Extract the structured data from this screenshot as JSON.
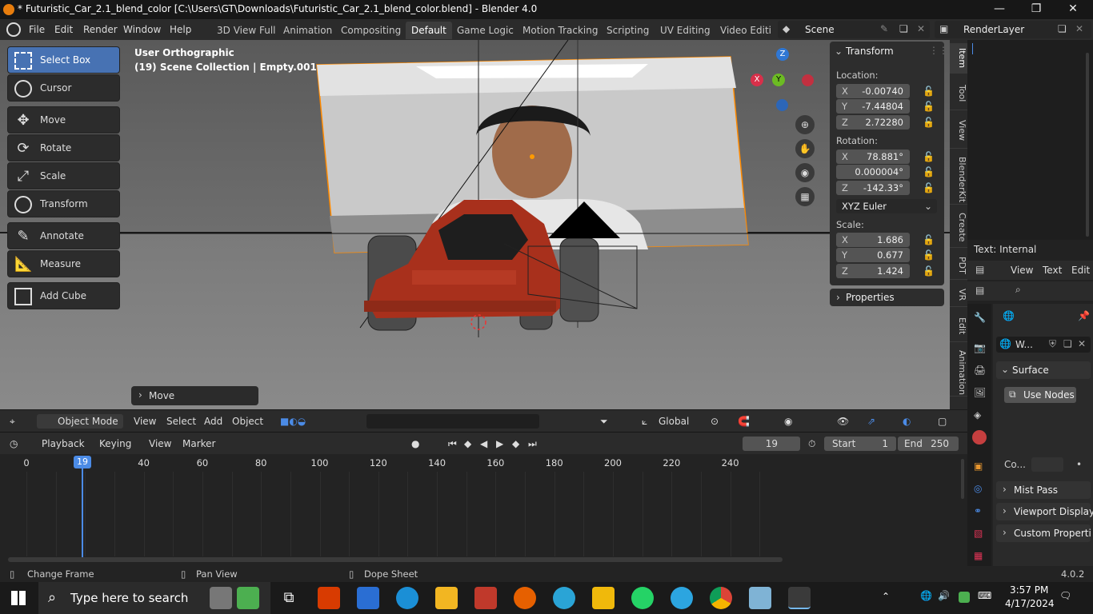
{
  "window": {
    "title": "* Futuristic_Car_2.1_blend_color [C:\\Users\\GT\\Downloads\\Futuristic_Car_2.1_blend_color.blend] - Blender 4.0",
    "minimize": "—",
    "maximize": "❐",
    "close": "✕"
  },
  "menus": [
    "File",
    "Edit",
    "Render",
    "Window",
    "Help"
  ],
  "workspaces": [
    "3D View Full",
    "Animation",
    "Compositing",
    "Default",
    "Game Logic",
    "Motion Tracking",
    "Scripting",
    "UV Editing",
    "Video Editir"
  ],
  "active_workspace": "Default",
  "scene": {
    "name": "Scene",
    "render_layer": "RenderLayer"
  },
  "toolbar": [
    {
      "label": "Select Box",
      "icon": "select-box-icon"
    },
    {
      "label": "Cursor",
      "icon": "cursor-icon"
    },
    {
      "label": "Move",
      "icon": "move-icon"
    },
    {
      "label": "Rotate",
      "icon": "rotate-icon"
    },
    {
      "label": "Scale",
      "icon": "scale-icon"
    },
    {
      "label": "Transform",
      "icon": "transform-icon"
    },
    {
      "label": "Annotate",
      "icon": "annotate-icon"
    },
    {
      "label": "Measure",
      "icon": "measure-icon"
    },
    {
      "label": "Add Cube",
      "icon": "add-cube-icon"
    }
  ],
  "viewport": {
    "view_name": "User Orthographic",
    "collection": "(19) Scene Collection | Empty.001",
    "last_operation": "Move",
    "gizmo": {
      "z": "Z",
      "y": "Y",
      "x": "X"
    }
  },
  "transform_panel": {
    "header": "Transform",
    "location_label": "Location:",
    "location": [
      {
        "axis": "X",
        "value": "-0.00740"
      },
      {
        "axis": "Y",
        "value": "-7.44804"
      },
      {
        "axis": "Z",
        "value": "2.72280"
      }
    ],
    "rotation_label": "Rotation:",
    "rotation": [
      {
        "axis": "X",
        "value": "78.881°"
      },
      {
        "axis": "",
        "value": "0.000004°"
      },
      {
        "axis": "Z",
        "value": "-142.33°"
      }
    ],
    "rotation_mode": "XYZ Euler",
    "scale_label": "Scale:",
    "scale": [
      {
        "axis": "X",
        "value": "1.686"
      },
      {
        "axis": "Y",
        "value": "0.677"
      },
      {
        "axis": "Z",
        "value": "1.424"
      }
    ],
    "properties_header": "Properties"
  },
  "side_tabs": [
    "Item",
    "Tool",
    "View",
    "BlenderKit",
    "Create",
    "PDT",
    "VR",
    "Edit",
    "Animation"
  ],
  "text_editor": {
    "title": "Text: Internal",
    "menus": [
      "View",
      "Text",
      "Edit"
    ]
  },
  "properties": {
    "world_name": "W...",
    "surface_header": "Surface",
    "use_nodes": "Use Nodes",
    "color_label": "Co...",
    "mist_pass": "Mist Pass",
    "viewport_display": "Viewport Display",
    "custom_properties": "Custom Properti"
  },
  "viewport_header": {
    "mode": "Object Mode",
    "menus": [
      "View",
      "Select",
      "Add",
      "Object"
    ],
    "orientation": "Global"
  },
  "timeline_header": {
    "menus": [
      "Playback",
      "Keying",
      "View",
      "Marker"
    ],
    "current_frame": "19",
    "start_label": "Start",
    "start": "1",
    "end_label": "End",
    "end": "250"
  },
  "timeline": {
    "ticks": [
      "0",
      "20",
      "40",
      "60",
      "80",
      "100",
      "120",
      "140",
      "160",
      "180",
      "200",
      "220",
      "240"
    ],
    "current": "19"
  },
  "statusbar": {
    "left": "Change Frame",
    "middle": "Pan View",
    "right": "Dope Sheet",
    "version": "4.0.2"
  },
  "taskbar": {
    "search_placeholder": "Type here to search",
    "time": "3:57 PM",
    "date": "4/17/2024"
  }
}
